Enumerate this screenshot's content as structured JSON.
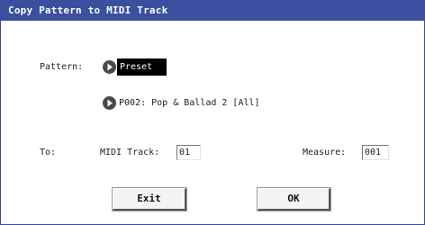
{
  "dialog": {
    "title": "Copy Pattern to MIDI Track"
  },
  "pattern": {
    "label": "Pattern:",
    "bank_value": "Preset",
    "pattern_value": "P002: Pop & Ballad 2 [All]"
  },
  "to": {
    "label": "To:",
    "midi_track_label": "MIDI Track:",
    "midi_track_value": "01",
    "measure_label": "Measure:",
    "measure_value": "001"
  },
  "buttons": {
    "exit_label": "Exit",
    "ok_label": "OK"
  },
  "colors": {
    "titlebar": "#3b4fa0",
    "selected_field_bg": "#000000"
  },
  "icons": {
    "popup": "popup-arrow-icon"
  }
}
